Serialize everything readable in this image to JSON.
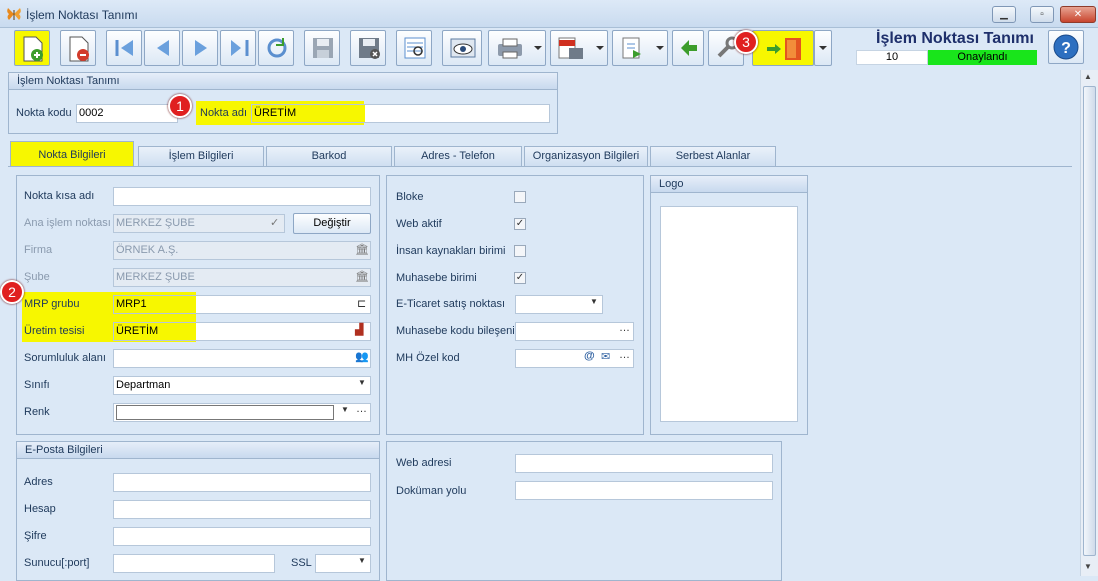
{
  "window": {
    "title": "İşlem Noktası Tanımı"
  },
  "header": {
    "title": "İşlem Noktası Tanımı",
    "record_no": "10",
    "status": "Onaylandı",
    "status_color": "#19e51b"
  },
  "toolbar": {
    "buttons": [
      "new-document-icon",
      "delete-document-icon",
      "first-record-icon",
      "previous-record-icon",
      "next-record-icon",
      "last-record-icon",
      "refresh-icon",
      "save-icon",
      "save-close-icon",
      "preview-icon",
      "view-icon",
      "print-icon",
      "pdf-export-icon",
      "export-icon",
      "back-icon",
      "tools-icon",
      "exit-icon",
      "help-icon"
    ]
  },
  "markers": [
    "1",
    "2",
    "3"
  ],
  "top_panel": {
    "title": "İşlem Noktası Tanımı",
    "code_label": "Nokta kodu",
    "code_value": "0002",
    "name_label": "Nokta adı",
    "name_value": "ÜRETİM"
  },
  "tabs": [
    "Nokta Bilgileri",
    "İşlem Bilgileri",
    "Barkod",
    "Adres - Telefon",
    "Organizasyon Bilgileri",
    "Serbest Alanlar"
  ],
  "left": {
    "short_name": {
      "label": "Nokta kısa adı",
      "value": ""
    },
    "main_point": {
      "label": "Ana işlem noktası",
      "value": "MERKEZ ŞUBE",
      "button": "Değiştir"
    },
    "firm": {
      "label": "Firma",
      "value": "ÖRNEK A.Ş."
    },
    "branch": {
      "label": "Şube",
      "value": "MERKEZ ŞUBE"
    },
    "mrp": {
      "label": "MRP grubu",
      "value": "MRP1"
    },
    "plant": {
      "label": "Üretim tesisi",
      "value": "ÜRETİM"
    },
    "responsibility": {
      "label": "Sorumluluk alanı",
      "value": ""
    },
    "class": {
      "label": "Sınıfı",
      "value": "Departman"
    },
    "color": {
      "label": "Renk",
      "value": ""
    }
  },
  "middle": {
    "block": {
      "label": "Bloke",
      "checked": false
    },
    "web_active": {
      "label": "Web aktif",
      "checked": true
    },
    "hr_unit": {
      "label": "İnsan kaynakları birimi",
      "checked": false
    },
    "accounting_unit": {
      "label": "Muhasebe birimi",
      "checked": true
    },
    "ecommerce": {
      "label": "E-Ticaret satış noktası",
      "value": ""
    },
    "acc_code": {
      "label": "Muhasebe kodu bileşeni",
      "value": ""
    },
    "mh_code": {
      "label": "MH Özel kod",
      "value": ""
    }
  },
  "logo": {
    "title": "Logo"
  },
  "email": {
    "title": "E-Posta Bilgileri",
    "address": "Adres",
    "account": "Hesap",
    "password": "Şifre",
    "server": "Sunucu[:port]",
    "ssl": "SSL"
  },
  "web": {
    "web_address": "Web adresi",
    "doc_path": "Doküman yolu"
  }
}
